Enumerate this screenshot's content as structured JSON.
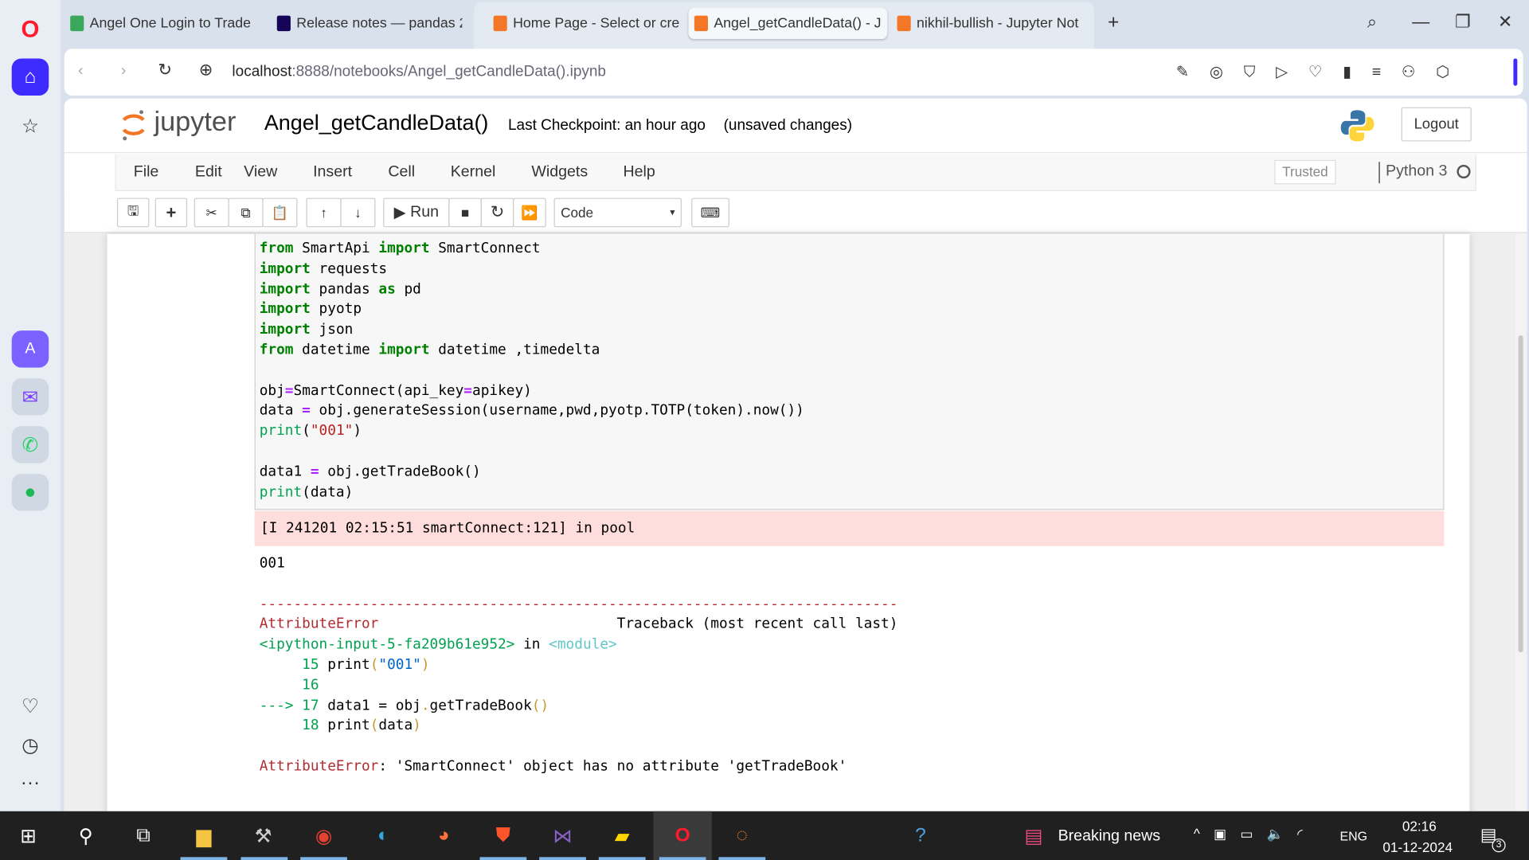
{
  "browser": {
    "tabs": [
      {
        "label": "Angel One Login to Trade",
        "color": "#3aa85c"
      },
      {
        "label": "Release notes — pandas 2",
        "color": "#150458"
      },
      {
        "label": "Home Page - Select or cre",
        "color": "#f37726"
      },
      {
        "label": "Angel_getCandleData() - J",
        "color": "#f37726",
        "active": true
      },
      {
        "label": "nikhil-bullish - Jupyter Not",
        "color": "#f37726"
      }
    ],
    "new_tab": "+",
    "url_host": "localhost",
    "url_path": ":8888/notebooks/Angel_getCandleData().ipynb"
  },
  "jupyter": {
    "logo": "jupyter",
    "notebook_name": "Angel_getCandleData()",
    "checkpoint": "Last Checkpoint: an hour ago",
    "unsaved": "(unsaved changes)",
    "logout": "Logout",
    "menu": [
      "File",
      "Edit",
      "View",
      "Insert",
      "Cell",
      "Kernel",
      "Widgets",
      "Help"
    ],
    "trusted": "Trusted",
    "kernel": "Python 3",
    "run_label": "Run",
    "cell_type": "Code"
  },
  "code": [
    [
      [
        "from",
        "kw"
      ],
      [
        " SmartApi ",
        ""
      ],
      [
        "import",
        "kw"
      ],
      [
        " SmartConnect",
        ""
      ]
    ],
    [
      [
        "import",
        "kw"
      ],
      [
        " requests",
        ""
      ]
    ],
    [
      [
        "import",
        "kw"
      ],
      [
        " pandas ",
        ""
      ],
      [
        "as",
        "kw"
      ],
      [
        " pd",
        ""
      ]
    ],
    [
      [
        "import",
        "kw"
      ],
      [
        " pyotp",
        ""
      ]
    ],
    [
      [
        "import",
        "kw"
      ],
      [
        " json",
        ""
      ]
    ],
    [
      [
        "from",
        "kw"
      ],
      [
        " datetime ",
        ""
      ],
      [
        "import",
        "kw"
      ],
      [
        " datetime ,timedelta",
        ""
      ]
    ],
    [],
    [
      [
        "obj",
        ""
      ],
      [
        "=",
        "op"
      ],
      [
        "SmartConnect(api_key",
        ""
      ],
      [
        "=",
        "op"
      ],
      [
        "apikey)",
        ""
      ]
    ],
    [
      [
        "data ",
        ""
      ],
      [
        "=",
        "op"
      ],
      [
        " obj.generateSession(username,pwd,pyotp.TOTP(token).now())",
        ""
      ]
    ],
    [
      [
        "print",
        "gr"
      ],
      [
        "(",
        ""
      ],
      [
        "\"001\"",
        "st"
      ],
      [
        ")",
        ""
      ]
    ],
    [],
    [
      [
        "data1 ",
        ""
      ],
      [
        "=",
        "op"
      ],
      [
        " obj.getTradeBook()",
        ""
      ]
    ],
    [
      [
        "print",
        "gr"
      ],
      [
        "(data)",
        ""
      ]
    ]
  ],
  "stderr": "[I 241201 02:15:51 smartConnect:121] in pool",
  "output": [
    [
      [
        "001",
        ""
      ]
    ],
    [],
    [
      [
        "---------------------------------------------------------------------------",
        "er"
      ]
    ],
    [
      [
        "AttributeError",
        "er"
      ],
      [
        "                            Traceback (most recent call last)",
        ""
      ]
    ],
    [
      [
        "<ipython-input-5-fa209b61e952>",
        "gr"
      ],
      [
        " in ",
        ""
      ],
      [
        "<module>",
        "cy"
      ]
    ],
    [
      [
        "     15 ",
        "ln"
      ],
      [
        "print",
        ""
      ],
      [
        "(",
        "yl"
      ],
      [
        "\"001\"",
        "bl"
      ],
      [
        ")",
        "yl"
      ]
    ],
    [
      [
        "     16",
        "ln"
      ]
    ],
    [
      [
        "---> 17 ",
        "gr"
      ],
      [
        "data1 = obj",
        ""
      ],
      [
        ".",
        "yl"
      ],
      [
        "getTradeBook",
        ""
      ],
      [
        "()",
        "yl"
      ]
    ],
    [
      [
        "     18 ",
        "ln"
      ],
      [
        "print",
        ""
      ],
      [
        "(",
        "yl"
      ],
      [
        "data",
        ""
      ],
      [
        ")",
        "yl"
      ]
    ],
    [],
    [
      [
        "AttributeError",
        "er"
      ],
      [
        ": 'SmartConnect' object has no attribute 'getTradeBook'",
        ""
      ]
    ]
  ],
  "taskbar": {
    "news": "Breaking news",
    "lang": "ENG",
    "time": "02:16",
    "date": "01-12-2024",
    "notifications": "3"
  }
}
